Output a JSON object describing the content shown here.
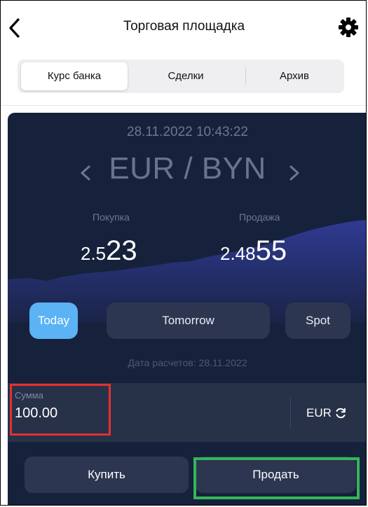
{
  "header": {
    "title": "Торговая площадка",
    "back_icon": "chevron-left-icon",
    "settings_icon": "gear-icon"
  },
  "tabs": [
    {
      "label": "Курс банка",
      "active": true
    },
    {
      "label": "Сделки",
      "active": false
    },
    {
      "label": "Архив",
      "active": false
    }
  ],
  "panel": {
    "datetime": "28.11.2022 10:43:22",
    "pair": "EUR / BYN",
    "buy_label": "Покупка",
    "sell_label": "Продажа",
    "buy_rate_prefix": "2.5",
    "buy_rate_suffix": "23",
    "sell_rate_prefix": "2.48",
    "sell_rate_suffix": "55",
    "periods": [
      {
        "label": "Today",
        "active": true
      },
      {
        "label": "Tomorrow",
        "active": false
      },
      {
        "label": "Spot",
        "active": false
      }
    ],
    "settlement": "Дата расчетов: 28.11.2022",
    "amount_label": "Сумма",
    "amount_value": "100.00",
    "currency": "EUR",
    "buy_button": "Купить",
    "sell_button": "Продать"
  },
  "colors": {
    "panel_bg": "#16213b",
    "accent": "#5bb2f5",
    "annotation_red": "#e53030",
    "annotation_green": "#34b65a"
  }
}
